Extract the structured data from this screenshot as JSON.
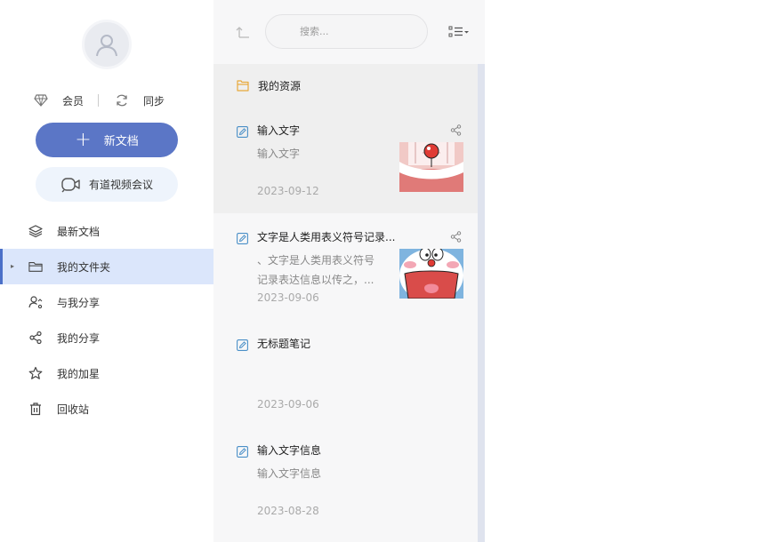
{
  "sidebar": {
    "member_label": "会员",
    "sync_label": "同步",
    "new_doc_label": "新文档",
    "meeting_label": "有道视频会议",
    "nav": [
      {
        "label": "最新文档",
        "icon": "layers-icon"
      },
      {
        "label": "我的文件夹",
        "icon": "folder-icon"
      },
      {
        "label": "与我分享",
        "icon": "shared-with-me-icon"
      },
      {
        "label": "我的分享",
        "icon": "share-icon"
      },
      {
        "label": "我的加星",
        "icon": "star-icon"
      },
      {
        "label": "回收站",
        "icon": "trash-icon"
      }
    ]
  },
  "toolbar": {
    "search_placeholder": "搜索..."
  },
  "list": {
    "folder_label": "我的资源",
    "notes": [
      {
        "title": "输入文字",
        "snippet": "输入文字",
        "date": "2023-09-12"
      },
      {
        "title": "文字是人类用表义符号记录...",
        "snippet": "、文字是人类用表义符号记录表达信息以传之，...",
        "date": "2023-09-06"
      },
      {
        "title": "无标题笔记",
        "snippet": "",
        "date": "2023-09-06"
      },
      {
        "title": "输入文字信息",
        "snippet": "输入文字信息",
        "date": "2023-08-28"
      }
    ]
  },
  "colors": {
    "accent": "#5b76c6",
    "active_nav": "#dbe6fb",
    "meeting_bg": "#eef4fc"
  }
}
